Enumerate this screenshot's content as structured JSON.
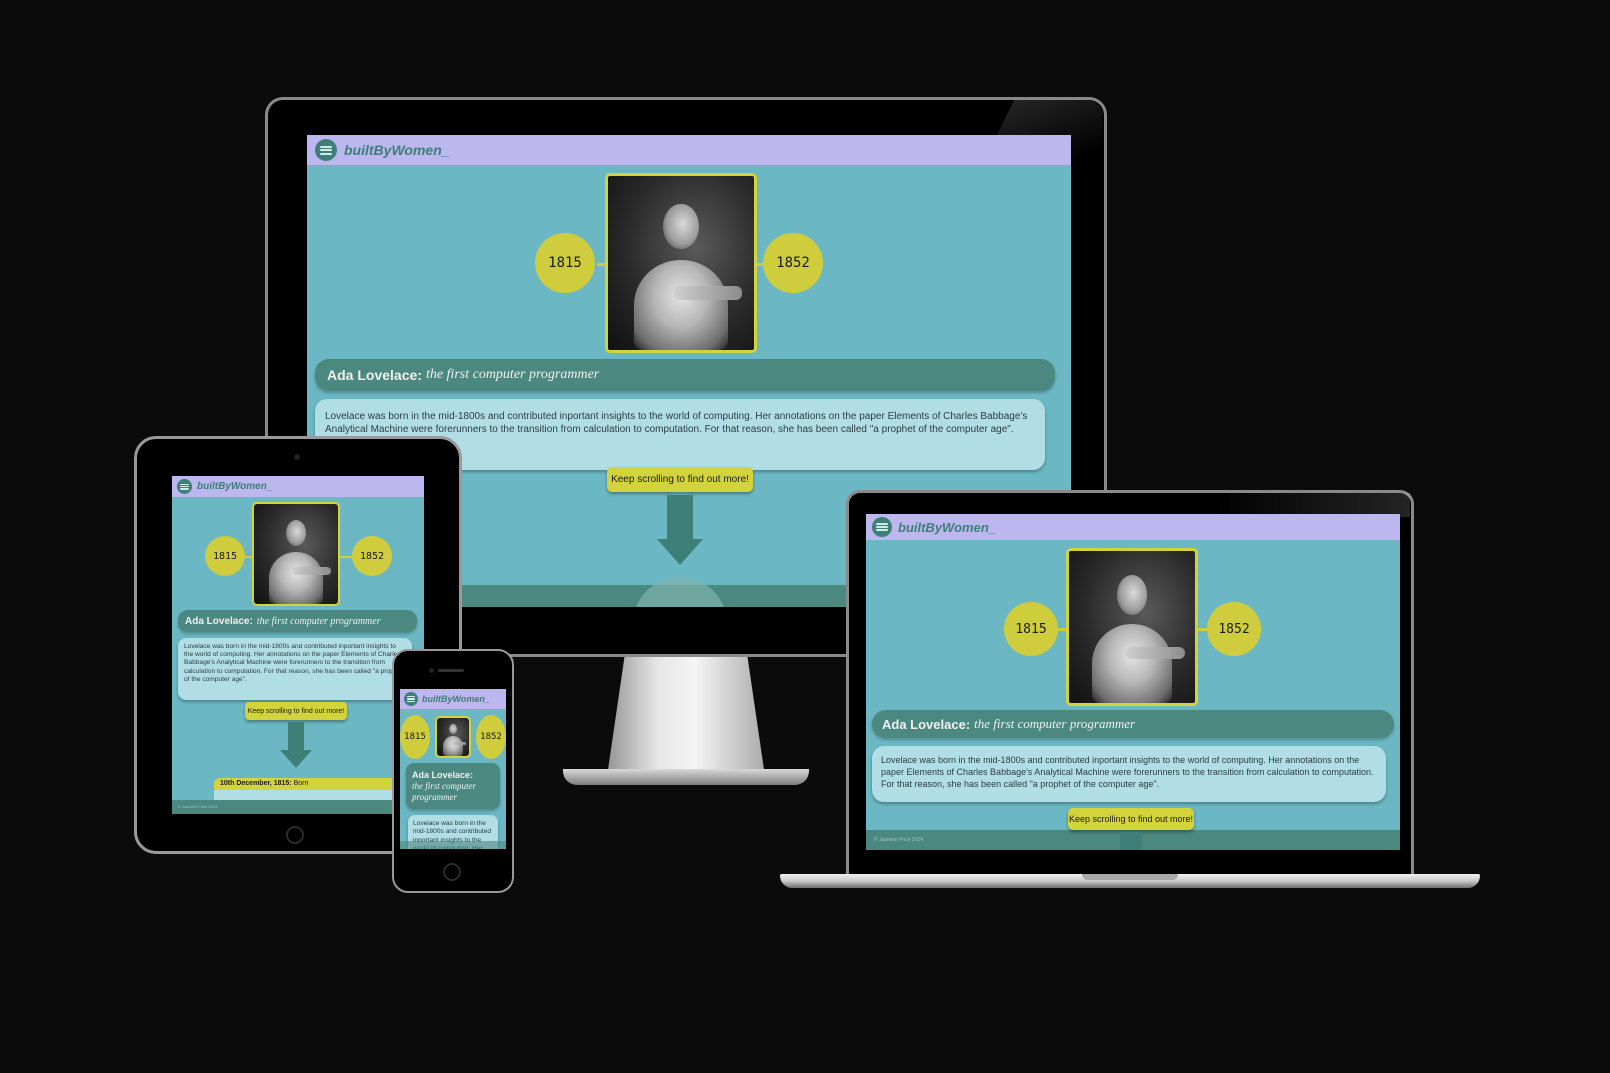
{
  "site": {
    "brand": "builtByWomen_",
    "birth_year": "1815",
    "death_year": "1852",
    "title_name": "Ada Lovelace:",
    "title_sub": "the first computer programmer",
    "bio_text": "Lovelace was born in the mid-1800s and contributed inportant insights to the world of computing. Her annotations on the paper Elements of Charles Babbage's Analytical Machine were forerunners to the transition from calculation to computation. For that reason, she has been called \"a prophet of the computer age\".",
    "scroll_label": "Keep scrolling to find out more!",
    "tablet_scroll_label": "Keep scrolling to find out more!",
    "timeline_date": "10th December, 1815:",
    "timeline_event": "Born",
    "footer": "© Jasmine Price 2024"
  },
  "colors": {
    "background": "#0b0b0c",
    "page": "#6bb8c4",
    "nav": "#bcb7ee",
    "accent": "#cfcd3d",
    "teal_dark": "#4a8880",
    "bio_box": "#b1dde5"
  },
  "icons": {
    "menu": "hamburger-menu-icon",
    "scroll": "arrow-down-icon"
  }
}
